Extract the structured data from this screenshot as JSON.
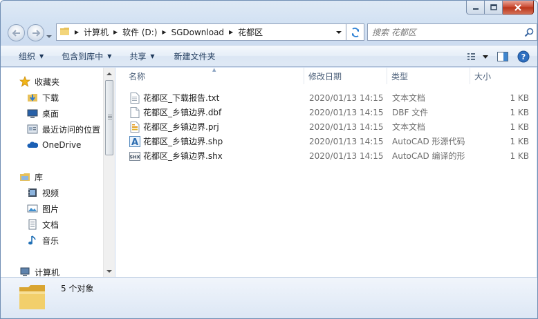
{
  "window": {
    "caption_buttons": [
      "minimize-icon",
      "maximize-icon",
      "close-icon"
    ]
  },
  "address": {
    "crumbs": [
      "计算机",
      "软件 (D:)",
      "SGDownload",
      "花都区"
    ]
  },
  "search": {
    "placeholder": "搜索 花都区"
  },
  "toolbar": {
    "organize": "组织",
    "include_in_library": "包含到库中",
    "share": "共享",
    "new_folder": "新建文件夹"
  },
  "navpane": {
    "favorites": "收藏夹",
    "downloads": "下载",
    "desktop": "桌面",
    "recent": "最近访问的位置",
    "onedrive": "OneDrive",
    "libraries": "库",
    "videos": "视频",
    "pictures": "图片",
    "documents": "文档",
    "music": "音乐",
    "computer": "计算机"
  },
  "columns": {
    "name": "名称",
    "date": "修改日期",
    "type": "类型",
    "size": "大小"
  },
  "files": [
    {
      "name": "花都区_下载报告.txt",
      "date": "2020/01/13 14:15",
      "type": "文本文档",
      "size": "1 KB",
      "icon": "text-file-icon"
    },
    {
      "name": "花都区_乡镇边界.dbf",
      "date": "2020/01/13 14:15",
      "type": "DBF 文件",
      "size": "1 KB",
      "icon": "blank-file-icon"
    },
    {
      "name": "花都区_乡镇边界.prj",
      "date": "2020/01/13 14:15",
      "type": "文本文档",
      "size": "1 KB",
      "icon": "prj-file-icon"
    },
    {
      "name": "花都区_乡镇边界.shp",
      "date": "2020/01/13 14:15",
      "type": "AutoCAD 形源代码",
      "size": "1 KB",
      "icon": "autocad-shp-icon"
    },
    {
      "name": "花都区_乡镇边界.shx",
      "date": "2020/01/13 14:15",
      "type": "AutoCAD 编译的形",
      "size": "1 KB",
      "icon": "autocad-shx-icon"
    }
  ],
  "details": {
    "count": "5 个对象"
  }
}
